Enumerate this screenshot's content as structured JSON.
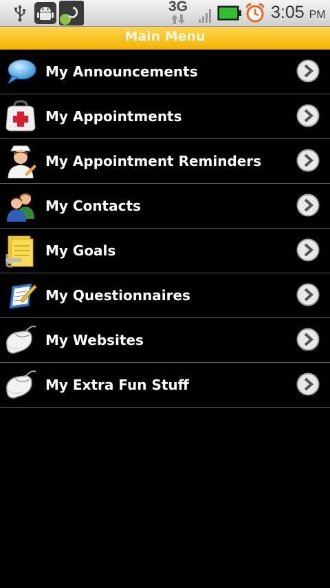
{
  "status_bar": {
    "network": "3G",
    "time": "3:05",
    "ampm": "PM",
    "icons": [
      "usb-icon",
      "android-debug-icon",
      "notification-icon",
      "network-3g-icon",
      "signal-icon",
      "battery-icon",
      "alarm-icon"
    ]
  },
  "header": {
    "title": "Main Menu"
  },
  "colors": {
    "header_bg": "#f4b800",
    "list_bg": "#000000",
    "divider": "#5a5a5a",
    "battery": "#2fc12f",
    "alarm": "#f2651e"
  },
  "menu": {
    "items": [
      {
        "label": "My Announcements",
        "icon": "speech-bubble-icon"
      },
      {
        "label": "My Appointments",
        "icon": "medical-bag-icon"
      },
      {
        "label": "My Appointment Reminders",
        "icon": "nurse-icon"
      },
      {
        "label": "My Contacts",
        "icon": "contacts-people-icon"
      },
      {
        "label": "My Goals",
        "icon": "notepad-clip-icon"
      },
      {
        "label": "My Questionnaires",
        "icon": "clipboard-pen-icon"
      },
      {
        "label": "My Websites",
        "icon": "computer-mouse-icon"
      },
      {
        "label": "My Extra Fun Stuff",
        "icon": "computer-mouse-icon"
      }
    ]
  }
}
